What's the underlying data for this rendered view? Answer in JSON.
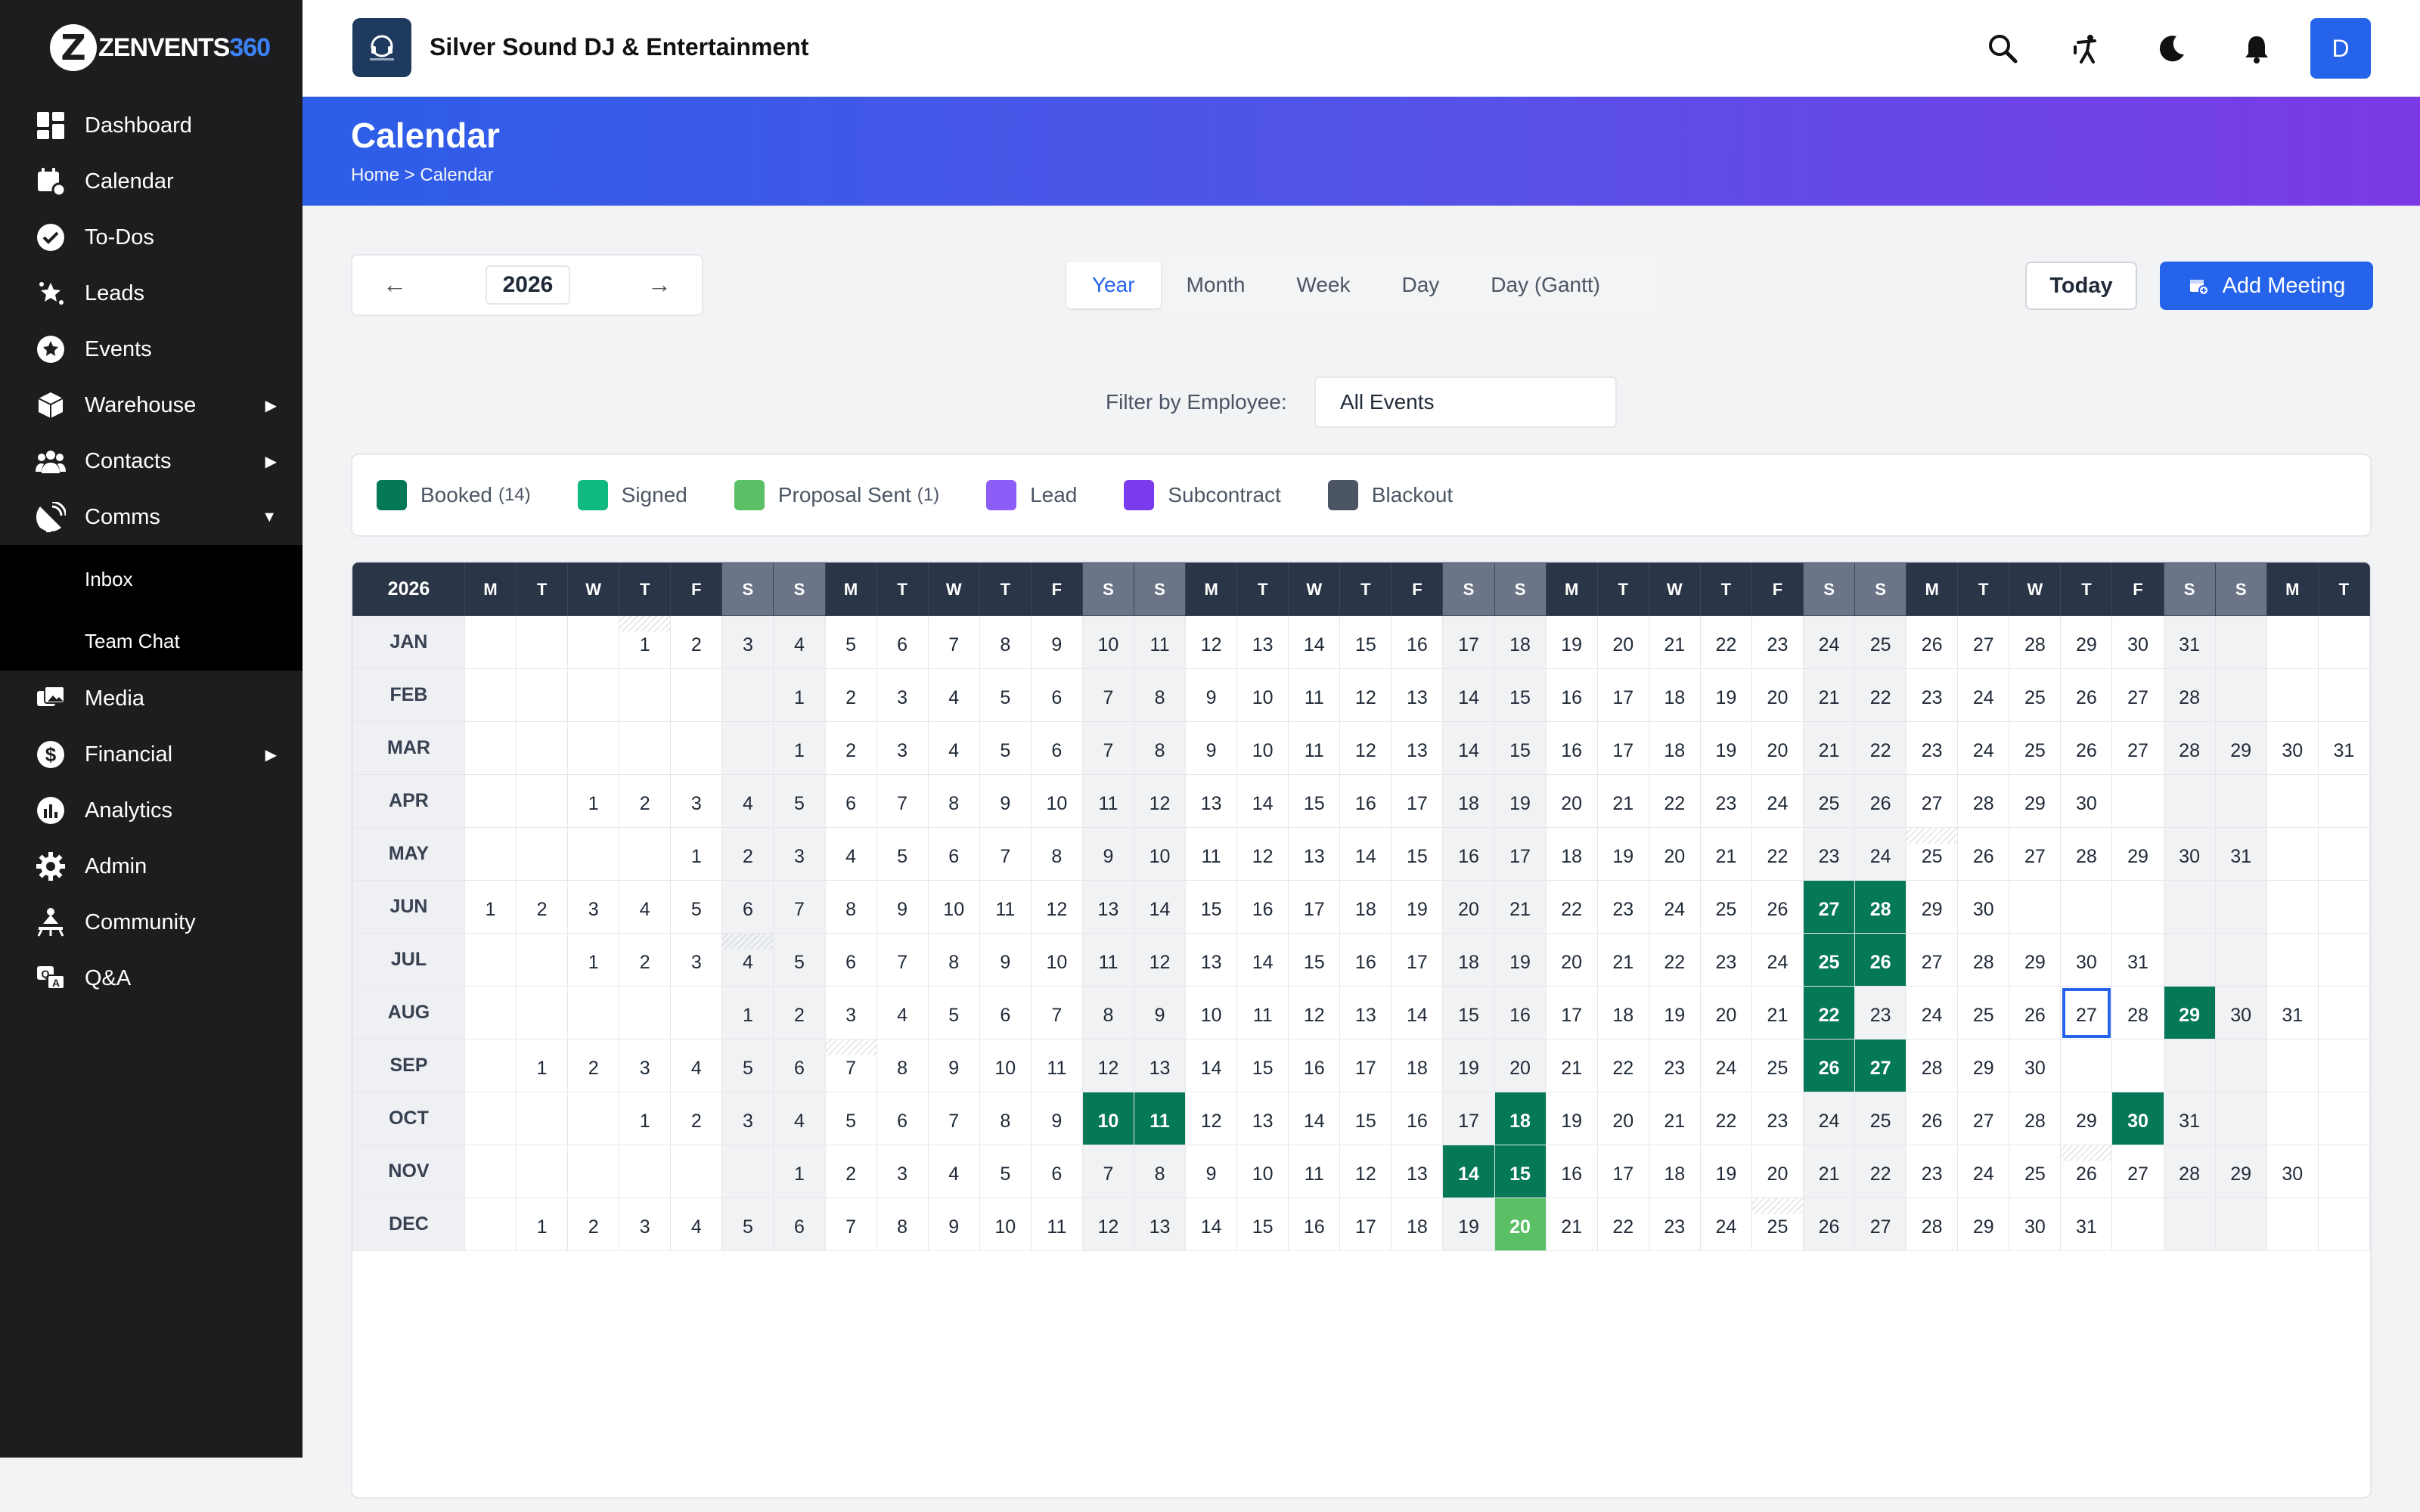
{
  "brand": {
    "logo_letter": "Z",
    "logo_main": "ZENVENTS",
    "logo_num": "360"
  },
  "sidebar": {
    "items": [
      {
        "label": "Dashboard",
        "icon": "dashboard-icon"
      },
      {
        "label": "Calendar",
        "icon": "calendar-icon"
      },
      {
        "label": "To-Dos",
        "icon": "check-circle-icon"
      },
      {
        "label": "Leads",
        "icon": "stars-icon"
      },
      {
        "label": "Events",
        "icon": "star-circle-icon"
      },
      {
        "label": "Warehouse",
        "icon": "box-icon",
        "arrow": "▶"
      },
      {
        "label": "Contacts",
        "icon": "users-icon",
        "arrow": "▶"
      },
      {
        "label": "Comms",
        "icon": "satellite-icon",
        "arrow": "▼",
        "open": true,
        "children": [
          "Inbox",
          "Team Chat"
        ]
      },
      {
        "label": "Media",
        "icon": "media-icon"
      },
      {
        "label": "Financial",
        "icon": "dollar-icon",
        "arrow": "▶"
      },
      {
        "label": "Analytics",
        "icon": "chart-icon"
      },
      {
        "label": "Admin",
        "icon": "gear-icon"
      },
      {
        "label": "Community",
        "icon": "community-icon"
      },
      {
        "label": "Q&A",
        "icon": "qa-icon"
      }
    ]
  },
  "topbar": {
    "company": "Silver Sound DJ & Entertainment",
    "avatar": "D"
  },
  "page": {
    "title": "Calendar",
    "breadcrumb": "Home > Calendar"
  },
  "toolbar": {
    "year": "2026",
    "prev": "←",
    "next": "→",
    "views": [
      "Year",
      "Month",
      "Week",
      "Day",
      "Day (Gantt)"
    ],
    "active_view": "Year",
    "today": "Today",
    "add_meeting": "Add Meeting"
  },
  "filter": {
    "label": "Filter by Employee:",
    "value": "All Events"
  },
  "legend": [
    {
      "label": "Booked",
      "count": "(14)",
      "color": "#047857"
    },
    {
      "label": "Signed",
      "count": "",
      "color": "#10b981"
    },
    {
      "label": "Proposal Sent",
      "count": "(1)",
      "color": "#5bbf66"
    },
    {
      "label": "Lead",
      "count": "",
      "color": "#8b5cf6"
    },
    {
      "label": "Subcontract",
      "count": "",
      "color": "#7c3aed"
    },
    {
      "label": "Blackout",
      "count": "",
      "color": "#4b5563"
    }
  ],
  "calendar": {
    "year": "2026",
    "weekdays": [
      "M",
      "T",
      "W",
      "T",
      "F",
      "S",
      "S",
      "M",
      "T",
      "W",
      "T",
      "F",
      "S",
      "S",
      "M",
      "T",
      "W",
      "T",
      "F",
      "S",
      "S",
      "M",
      "T",
      "W",
      "T",
      "F",
      "S",
      "S",
      "M",
      "T",
      "W",
      "T",
      "F",
      "S",
      "S",
      "M",
      "T"
    ],
    "months": [
      {
        "name": "JAN",
        "offset": 3,
        "days": 31,
        "booked": [],
        "proposal": [],
        "hatched": [
          1
        ]
      },
      {
        "name": "FEB",
        "offset": 6,
        "days": 28,
        "booked": [],
        "proposal": [],
        "hatched": []
      },
      {
        "name": "MAR",
        "offset": 6,
        "days": 31,
        "booked": [],
        "proposal": [],
        "hatched": []
      },
      {
        "name": "APR",
        "offset": 2,
        "days": 30,
        "booked": [],
        "proposal": [],
        "hatched": []
      },
      {
        "name": "MAY",
        "offset": 4,
        "days": 31,
        "booked": [],
        "proposal": [],
        "hatched": [
          25
        ]
      },
      {
        "name": "JUN",
        "offset": 0,
        "days": 30,
        "booked": [
          27,
          28
        ],
        "proposal": [],
        "hatched": []
      },
      {
        "name": "JUL",
        "offset": 2,
        "days": 31,
        "booked": [
          25,
          26
        ],
        "proposal": [],
        "hatched": [
          4
        ]
      },
      {
        "name": "AUG",
        "offset": 5,
        "days": 31,
        "booked": [
          22,
          29
        ],
        "proposal": [],
        "hatched": [],
        "today": 27
      },
      {
        "name": "SEP",
        "offset": 1,
        "days": 30,
        "booked": [
          26,
          27
        ],
        "proposal": [],
        "hatched": [
          7
        ]
      },
      {
        "name": "OCT",
        "offset": 3,
        "days": 31,
        "booked": [
          10,
          11,
          18,
          30
        ],
        "proposal": [],
        "hatched": []
      },
      {
        "name": "NOV",
        "offset": 6,
        "days": 30,
        "booked": [
          14,
          15
        ],
        "proposal": [],
        "hatched": [
          26
        ]
      },
      {
        "name": "DEC",
        "offset": 1,
        "days": 31,
        "booked": [],
        "proposal": [
          20
        ],
        "hatched": [
          25
        ]
      }
    ]
  }
}
